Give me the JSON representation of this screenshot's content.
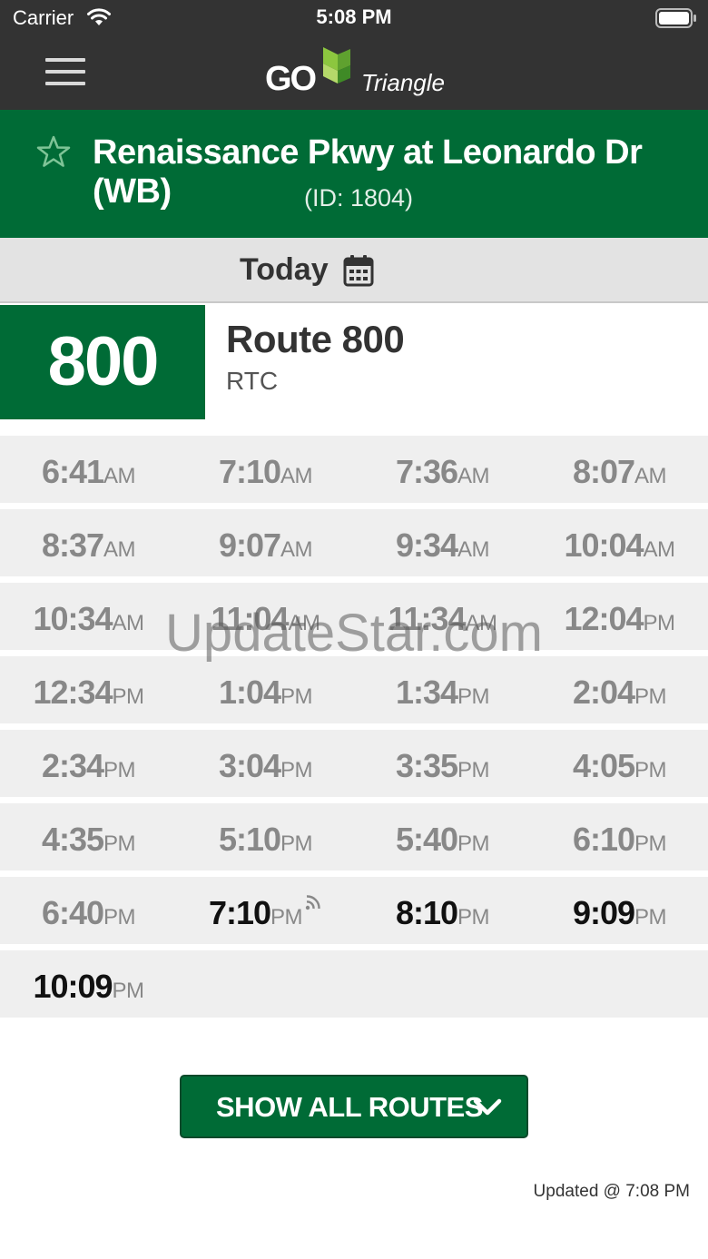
{
  "status_bar": {
    "carrier": "Carrier",
    "time": "5:08 PM"
  },
  "header": {
    "logo_go": "GO",
    "logo_triangle": "Triangle"
  },
  "stop": {
    "name": "Renaissance Pkwy at Leonardo Dr (WB)",
    "id_text": "(ID: 1804)"
  },
  "date": {
    "label": "Today"
  },
  "route": {
    "number": "800",
    "name": "Route 800",
    "subtitle": "RTC"
  },
  "times": [
    [
      {
        "t": "6:41",
        "ap": "AM"
      },
      {
        "t": "7:10",
        "ap": "AM"
      },
      {
        "t": "7:36",
        "ap": "AM"
      },
      {
        "t": "8:07",
        "ap": "AM"
      }
    ],
    [
      {
        "t": "8:37",
        "ap": "AM"
      },
      {
        "t": "9:07",
        "ap": "AM"
      },
      {
        "t": "9:34",
        "ap": "AM"
      },
      {
        "t": "10:04",
        "ap": "AM"
      }
    ],
    [
      {
        "t": "10:34",
        "ap": "AM"
      },
      {
        "t": "11:04",
        "ap": "AM"
      },
      {
        "t": "11:34",
        "ap": "AM"
      },
      {
        "t": "12:04",
        "ap": "PM"
      }
    ],
    [
      {
        "t": "12:34",
        "ap": "PM"
      },
      {
        "t": "1:04",
        "ap": "PM"
      },
      {
        "t": "1:34",
        "ap": "PM"
      },
      {
        "t": "2:04",
        "ap": "PM"
      }
    ],
    [
      {
        "t": "2:34",
        "ap": "PM"
      },
      {
        "t": "3:04",
        "ap": "PM"
      },
      {
        "t": "3:35",
        "ap": "PM"
      },
      {
        "t": "4:05",
        "ap": "PM"
      }
    ],
    [
      {
        "t": "4:35",
        "ap": "PM"
      },
      {
        "t": "5:10",
        "ap": "PM"
      },
      {
        "t": "5:40",
        "ap": "PM"
      },
      {
        "t": "6:10",
        "ap": "PM"
      }
    ],
    [
      {
        "t": "6:40",
        "ap": "PM"
      },
      {
        "t": "7:10",
        "ap": "PM",
        "realtime": true,
        "upcoming": true
      },
      {
        "t": "8:10",
        "ap": "PM",
        "upcoming": true
      },
      {
        "t": "9:09",
        "ap": "PM",
        "upcoming": true
      }
    ],
    [
      {
        "t": "10:09",
        "ap": "PM",
        "upcoming": true
      }
    ]
  ],
  "watermark": "UpdateStar.com",
  "show_all_button": {
    "label": "SHOW ALL ROUTES"
  },
  "updated_text": "Updated @ 7:08 PM",
  "colors": {
    "brand_green": "#006b36",
    "header_dark": "#333333",
    "logo_green": "#8cc63f"
  },
  "icons": [
    "menu-icon",
    "star-icon",
    "calendar-icon",
    "realtime-signal-icon",
    "chevron-down-icon",
    "wifi-icon",
    "battery-icon"
  ]
}
